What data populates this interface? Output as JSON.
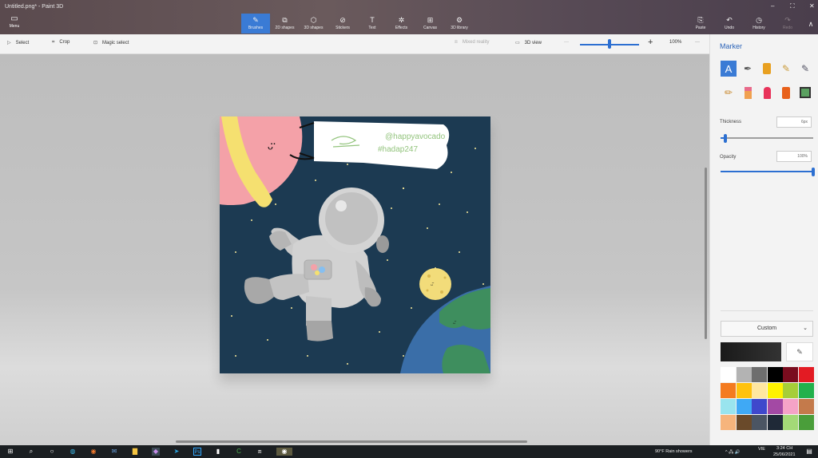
{
  "window": {
    "title": "Untitled.png* - Paint 3D",
    "minimize": "–",
    "maximize": "⛶",
    "close": "✕"
  },
  "toolbar": {
    "menu_label": "Menu",
    "tools": [
      {
        "label": "Brushes",
        "icon": "✎",
        "name": "brushes"
      },
      {
        "label": "2D shapes",
        "icon": "⧉",
        "name": "2d-shapes"
      },
      {
        "label": "3D shapes",
        "icon": "⬡",
        "name": "3d-shapes"
      },
      {
        "label": "Stickers",
        "icon": "⊘",
        "name": "stickers"
      },
      {
        "label": "Text",
        "icon": "T",
        "name": "text"
      },
      {
        "label": "Effects",
        "icon": "✲",
        "name": "effects"
      },
      {
        "label": "Canvas",
        "icon": "⊞",
        "name": "canvas"
      },
      {
        "label": "3D library",
        "icon": "⚙",
        "name": "3d-library"
      }
    ],
    "paste_label": "Paste",
    "undo_label": "Undo",
    "history_label": "History",
    "redo_label": "Redo",
    "collapse_icon": "∧"
  },
  "subbar": {
    "select_label": "Select",
    "crop_label": "Crop",
    "magic_select_label": "Magic select",
    "mixed_reality_label": "Mixed reality",
    "view3d_label": "3D view",
    "zoom_minus": "—",
    "zoom_plus": "+",
    "zoom_value": "100%",
    "more": "···",
    "zoom_level": 0.48
  },
  "canvas": {
    "handle": "@happyavocado",
    "tag": "#hadap247"
  },
  "panel": {
    "title": "Marker",
    "thickness_label": "Thickness",
    "thickness_value": "6px",
    "thickness_level": 0.05,
    "opacity_label": "Opacity",
    "opacity_value": "100%",
    "opacity_level": 1.0,
    "custom_label": "Custom",
    "picker_icon": "✎",
    "palette": [
      "#ffffff",
      "#b3b3b3",
      "#6e6e6e",
      "#000000",
      "#7a0c1e",
      "#e31b23",
      "#f47b20",
      "#ffc20e",
      "#ffe7a0",
      "#fff200",
      "#a6ce39",
      "#22b14c",
      "#99e4ee",
      "#3fa9f5",
      "#3f48cc",
      "#a349a4",
      "#f5a3c7",
      "#c47a4b",
      "#f6b47c",
      "#6a4a2a",
      "#4b5563",
      "#1f2937",
      "#a3d977",
      "#4a9e3a"
    ]
  },
  "taskbar": {
    "weather": "90°F  Rain showers",
    "lang": "VIE",
    "time": "3:24 CH",
    "date": "25/06/2021"
  }
}
